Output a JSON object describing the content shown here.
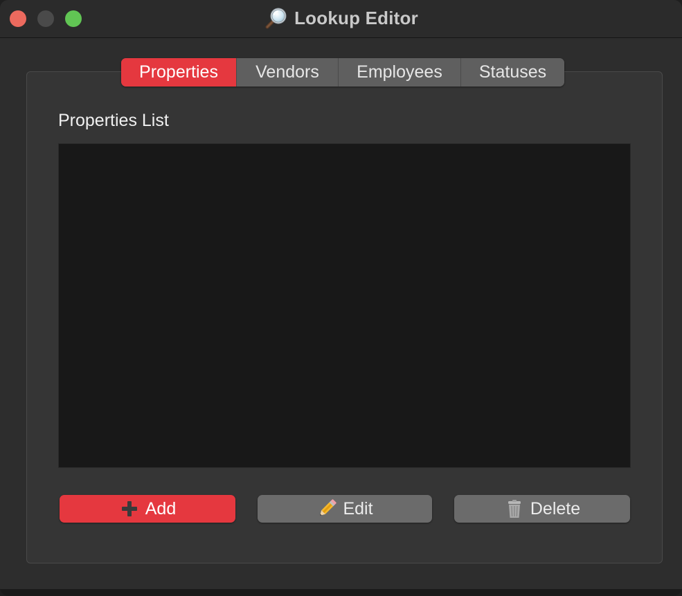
{
  "window": {
    "title": "Lookup Editor",
    "title_icon": "magnifying-glass-icon"
  },
  "tabs": [
    {
      "label": "Properties",
      "selected": true
    },
    {
      "label": "Vendors",
      "selected": false
    },
    {
      "label": "Employees",
      "selected": false
    },
    {
      "label": "Statuses",
      "selected": false
    }
  ],
  "list": {
    "label": "Properties List",
    "items": []
  },
  "buttons": {
    "add": {
      "label": "Add",
      "icon": "plus-icon"
    },
    "edit": {
      "label": "Edit",
      "icon": "pencil-icon"
    },
    "delete": {
      "label": "Delete",
      "icon": "trash-icon"
    }
  },
  "colors": {
    "accent": "#e5383f",
    "window_bg": "#2d2d2d",
    "panel_bg": "#353535",
    "list_bg": "#181818",
    "button_gray": "#6b6b6b"
  }
}
